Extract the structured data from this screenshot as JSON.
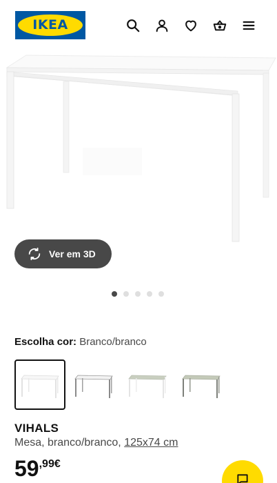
{
  "header": {
    "logo_text": "IKEA",
    "brand_blue": "#0058a3",
    "brand_yellow": "#ffdb00",
    "icons": [
      "search-icon",
      "user-icon",
      "heart-icon",
      "basket-icon",
      "menu-icon"
    ]
  },
  "gallery": {
    "view_3d_label": "Ver em 3D",
    "dot_count": 5,
    "active_dot": 1
  },
  "color_choice": {
    "label": "Escolha cor:",
    "selected_value": "Branco/branco"
  },
  "product": {
    "name": "VIHALS",
    "description_prefix": "Mesa, branco/branco, ",
    "dimensions": "125x74 cm",
    "price_integer": "59",
    "price_decimal": ",99€"
  }
}
